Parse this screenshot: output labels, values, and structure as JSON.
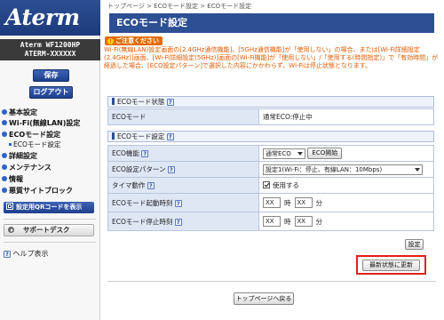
{
  "sidebar": {
    "logo": "Aterm",
    "model_line1": "Aterm WF1200HP",
    "model_line2": "ATERM-XXXXXX",
    "save_label": "保存",
    "logout_label": "ログアウト",
    "nav": [
      {
        "label": "基本設定"
      },
      {
        "label": "Wi-Fi(無線LAN)設定"
      },
      {
        "label": "ECOモード設定"
      },
      {
        "label": "ECOモード設定",
        "sub": true
      },
      {
        "label": "詳細設定"
      },
      {
        "label": "メンテナンス"
      },
      {
        "label": "情報"
      },
      {
        "label": "悪質サイトブロック"
      }
    ],
    "qr_label": "設定用QRコードを表示",
    "support_label": "サポートデスク",
    "help_label": "ヘルプ表示"
  },
  "main": {
    "breadcrumb": "トップページ > ECOモード設定 > ECOモード設定",
    "title": "ECOモード設定",
    "notice_title": "ご注意ください",
    "notice_text": "Wi-Fi(無線LAN)設定画面の[2.4GHz通信機能]、[5GHz通信機能]が「使用しない」の場合、または[Wi-Fi詳細設定(2.4GHz)]画面、[Wi-Fi詳細設定(5GHz)]画面の[Wi-Fi機能]が「使用しない」/「使用する(時間指定)」で「有効時間」が経過した場合、[ECO設定パターン]で選択した内容にかかわらず、Wi-Fiは停止状態となります。",
    "status_section": "ECOモード状態",
    "status_label": "ECOモード",
    "status_value": "通常ECO:停止中",
    "setting_section": "ECOモード設定",
    "eco_function_label": "ECO機能",
    "eco_function_value": "通常ECO",
    "eco_start_label": "ECO開始",
    "pattern_label": "ECO設定パターン",
    "pattern_value": "設定1(Wi-Fi：停止、有線LAN：10Mbps)",
    "timer_label": "タイマ動作",
    "timer_check_label": "使用する",
    "start_time_label": "ECOモード起動時刻",
    "stop_time_label": "ECOモード停止時刻",
    "hour_placeholder": "XX",
    "min_placeholder": "XX",
    "hour_unit": "時",
    "min_unit": "分",
    "set_label": "設定",
    "refresh_label": "最新状態に更新",
    "back_label": "トップページへ戻る"
  },
  "help_icon": "?",
  "colors": {
    "brand": "#2d4f93",
    "warning": "#e25a00",
    "highlight": "#e0201b"
  }
}
